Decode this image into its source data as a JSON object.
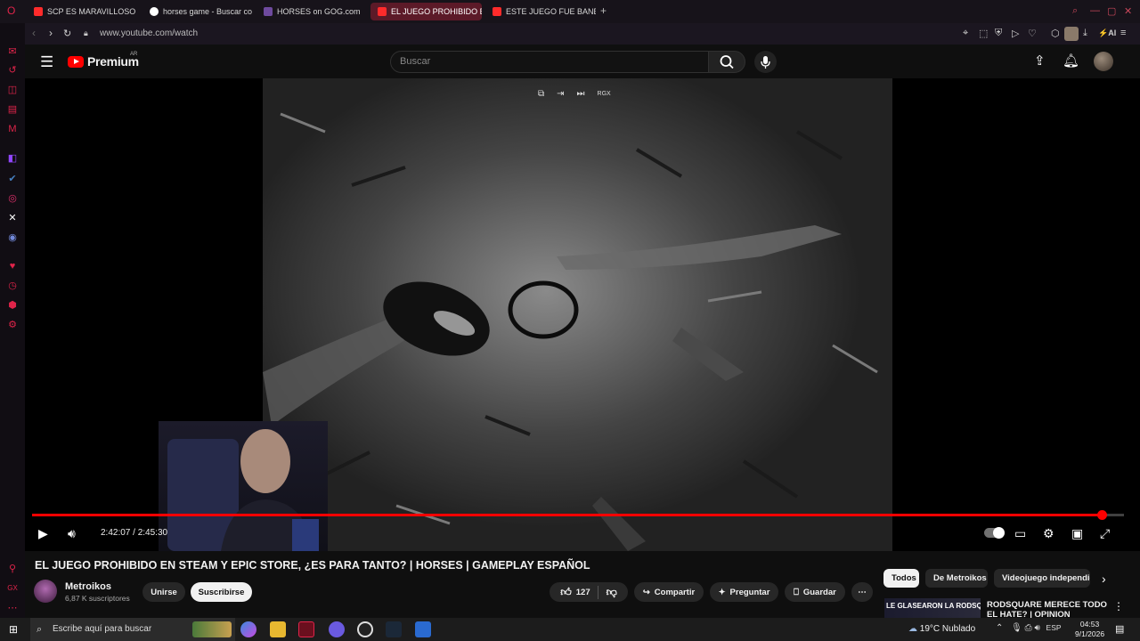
{
  "browser": {
    "tabs": [
      {
        "label": "SCP ES MARAVILLOSO - Y",
        "favicon": "youtube-icon",
        "active": false
      },
      {
        "label": "horses game - Buscar co",
        "favicon": "google-icon",
        "active": false
      },
      {
        "label": "HORSES on GOG.com",
        "favicon": "gog-icon",
        "active": false
      },
      {
        "label": "EL JUEGO PROHIBIDO EN",
        "favicon": "youtube-icon",
        "active": true
      },
      {
        "label": "ESTE JUEGO FUE BANEAD",
        "favicon": "youtube-icon",
        "active": false
      }
    ],
    "new_tab_label": "+",
    "url": "www.youtube.com/watch",
    "ai_label": "AI",
    "accent": "#e0244a"
  },
  "youtube": {
    "logo_text": "Premium",
    "country_code": "AR",
    "search_placeholder": "Buscar"
  },
  "player": {
    "current_time": "2:42:07",
    "duration": "2:45:30",
    "time_separator": " / ",
    "progress_fraction": 0.98,
    "overlay_label": "RGX"
  },
  "video": {
    "title": "EL JUEGO PROHIBIDO EN STEAM Y EPIC STORE, ¿ES PARA TANTO? | HORSES | GAMEPLAY ESPAÑOL",
    "channel_name": "Metroikos",
    "subscribers": "6,87 K suscriptores",
    "join_label": "Unirse",
    "subscribe_label": "Suscribirse",
    "likes": "127",
    "share_label": "Compartir",
    "ask_label": "Preguntar",
    "save_label": "Guardar"
  },
  "recommendations": {
    "chips": [
      "Todos",
      "De Metroikos",
      "Videojuego independien"
    ],
    "first_thumb_text": "LE GLASEARON LA RODSQUARE",
    "first_title": "RODSQUARE MERECE TODO EL HATE? | OPINION"
  },
  "taskbar": {
    "search_placeholder": "Escribe aquí para buscar",
    "weather": "19°C  Nublado",
    "language": "ESP",
    "time": "04:53",
    "date": "9/1/2026"
  }
}
